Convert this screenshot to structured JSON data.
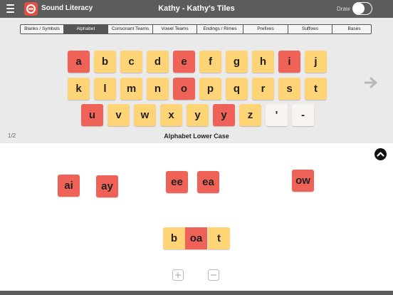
{
  "app": {
    "name": "Sound Literacy",
    "title": "Kathy - Kathy's Tiles",
    "draw_label": "Draw"
  },
  "colors": {
    "tile_yellow": "#ffd477",
    "tile_red": "#ef6258",
    "tile_white": "#f8f4f2",
    "bar": "#5c5c5c"
  },
  "tabs": [
    {
      "label": "Blanks / Symbols"
    },
    {
      "label": "Alphabet",
      "active": true
    },
    {
      "label": "Consonant Teams"
    },
    {
      "label": "Vowel Teams"
    },
    {
      "label": "Endings / Rimes"
    },
    {
      "label": "Prefixes"
    },
    {
      "label": "Suffixes"
    },
    {
      "label": "Bases"
    }
  ],
  "alphabet_tiles": [
    {
      "letter": "a",
      "color": "red"
    },
    {
      "letter": "b",
      "color": "yellow"
    },
    {
      "letter": "c",
      "color": "yellow"
    },
    {
      "letter": "d",
      "color": "yellow"
    },
    {
      "letter": "e",
      "color": "red"
    },
    {
      "letter": "f",
      "color": "yellow"
    },
    {
      "letter": "g",
      "color": "yellow"
    },
    {
      "letter": "h",
      "color": "yellow"
    },
    {
      "letter": "i",
      "color": "red"
    },
    {
      "letter": "j",
      "color": "yellow"
    },
    {
      "letter": "k",
      "color": "yellow"
    },
    {
      "letter": "l",
      "color": "yellow"
    },
    {
      "letter": "m",
      "color": "yellow"
    },
    {
      "letter": "n",
      "color": "yellow"
    },
    {
      "letter": "o",
      "color": "red"
    },
    {
      "letter": "p",
      "color": "yellow"
    },
    {
      "letter": "q",
      "color": "yellow"
    },
    {
      "letter": "r",
      "color": "yellow"
    },
    {
      "letter": "s",
      "color": "yellow"
    },
    {
      "letter": "t",
      "color": "yellow"
    },
    {
      "letter": "u",
      "color": "red"
    },
    {
      "letter": "v",
      "color": "yellow"
    },
    {
      "letter": "w",
      "color": "yellow"
    },
    {
      "letter": "x",
      "color": "yellow"
    },
    {
      "letter": "y",
      "color": "yellow"
    },
    {
      "letter": "y",
      "color": "red"
    },
    {
      "letter": "z",
      "color": "yellow"
    },
    {
      "letter": "'",
      "color": "white"
    },
    {
      "letter": "-",
      "color": "white"
    }
  ],
  "pagination": {
    "page": "1/2",
    "label": "Alphabet Lower Case"
  },
  "canvas_tiles": [
    {
      "text": "ai"
    },
    {
      "text": "ay"
    },
    {
      "text": "ee"
    },
    {
      "text": "ea"
    },
    {
      "text": "ow"
    }
  ],
  "word": [
    {
      "text": "b",
      "color": "yellow"
    },
    {
      "text": "oa",
      "color": "red"
    },
    {
      "text": "t",
      "color": "yellow"
    }
  ],
  "icons": {
    "menu": "hamburger-icon",
    "next": "arrow-right-icon",
    "collapse": "chevron-up-icon",
    "zoom_in": "plus-icon",
    "zoom_out": "minus-icon"
  }
}
